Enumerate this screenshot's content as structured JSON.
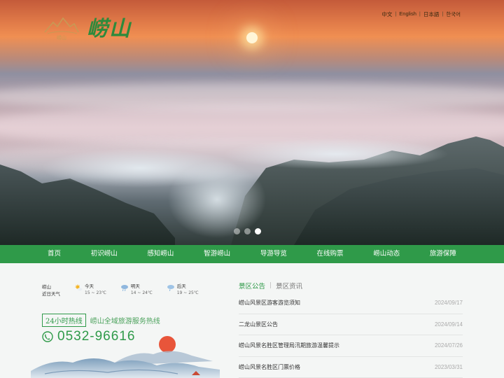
{
  "header": {
    "logo_alt": "崂山",
    "logo_emblem_text": "崂山",
    "languages": [
      {
        "label": "中文"
      },
      {
        "label": "English"
      },
      {
        "label": "日本語"
      },
      {
        "label": "한국어"
      }
    ],
    "separator": "|"
  },
  "carousel": {
    "slide_count": 3,
    "active_index": 3
  },
  "nav": {
    "items": [
      {
        "label": "首页"
      },
      {
        "label": "初识崂山"
      },
      {
        "label": "感知崂山"
      },
      {
        "label": "智游崂山"
      },
      {
        "label": "导游导览"
      },
      {
        "label": "在线购票"
      },
      {
        "label": "崂山动态"
      },
      {
        "label": "旅游保障"
      }
    ]
  },
  "weather": {
    "place": "崂山",
    "place_sub": "近日天气",
    "days": [
      {
        "label": "今天",
        "temp": "15 ~ 23℃",
        "icon": "sun-cloud-icon"
      },
      {
        "label": "明天",
        "temp": "14 ~ 24℃",
        "icon": "rain-cloud-icon"
      },
      {
        "label": "后天",
        "temp": "19 ~ 25℃",
        "icon": "rain-cloud-icon"
      }
    ]
  },
  "hotline": {
    "badge": "24小时热线",
    "description": "崂山全域旅游服务热线",
    "phone": "0532-96616"
  },
  "news": {
    "tab_active": "景区公告",
    "tab_inactive": "景区资讯",
    "tab_separator": "|",
    "items": [
      {
        "title": "崂山风景区游客游览须知",
        "date": "2024/09/17"
      },
      {
        "title": "二龙山景区公告",
        "date": "2024/09/14"
      },
      {
        "title": "崂山风景名胜区管理局汛期旅游温馨提示",
        "date": "2024/07/26"
      },
      {
        "title": "崂山风景名胜区门票价格",
        "date": "2023/03/31"
      }
    ]
  },
  "colors": {
    "brand_green": "#2f9a49",
    "nav_bg": "#2f9a49"
  }
}
